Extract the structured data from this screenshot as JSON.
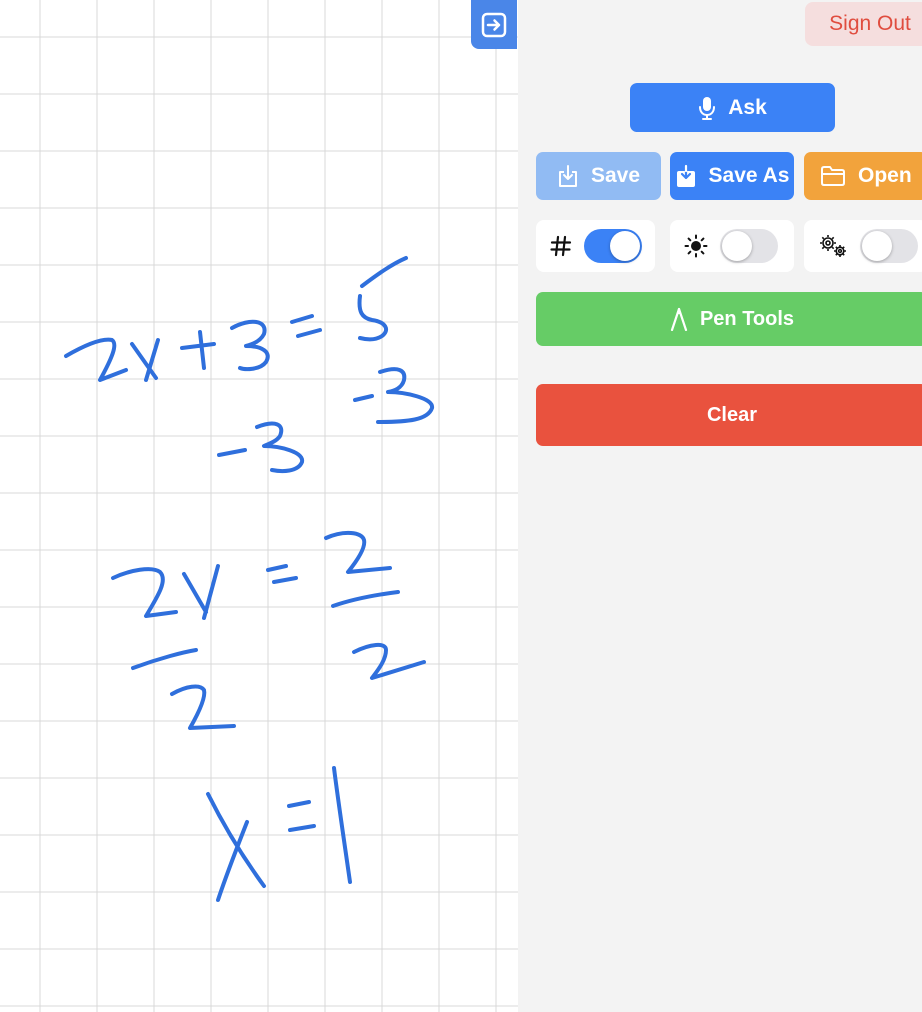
{
  "toolbar": {
    "sign_out_label": "Sign Out",
    "ask_label": "Ask",
    "save_label": "Save",
    "save_as_label": "Save As",
    "open_label": "Open",
    "pen_tools_label": "Pen Tools",
    "clear_label": "Clear"
  },
  "toggles": {
    "grid": {
      "icon": "hash-icon",
      "on": true
    },
    "brightness": {
      "icon": "sun-icon",
      "on": false
    },
    "settings": {
      "icon": "gears-icon",
      "on": false
    }
  },
  "canvas": {
    "grid_visible": true,
    "ink_color": "#2f6fdc",
    "handwriting": [
      "2x+3=5",
      "-3 -3",
      "2x = 2",
      "2 2",
      "x=1"
    ]
  },
  "colors": {
    "primary": "#3b82f6",
    "save_disabled": "#91bbf3",
    "open": "#f2a33c",
    "pen_tools": "#66cc66",
    "clear": "#e9523e",
    "sign_out_text": "#e04d3f",
    "panel_bg": "#f3f3f3"
  }
}
